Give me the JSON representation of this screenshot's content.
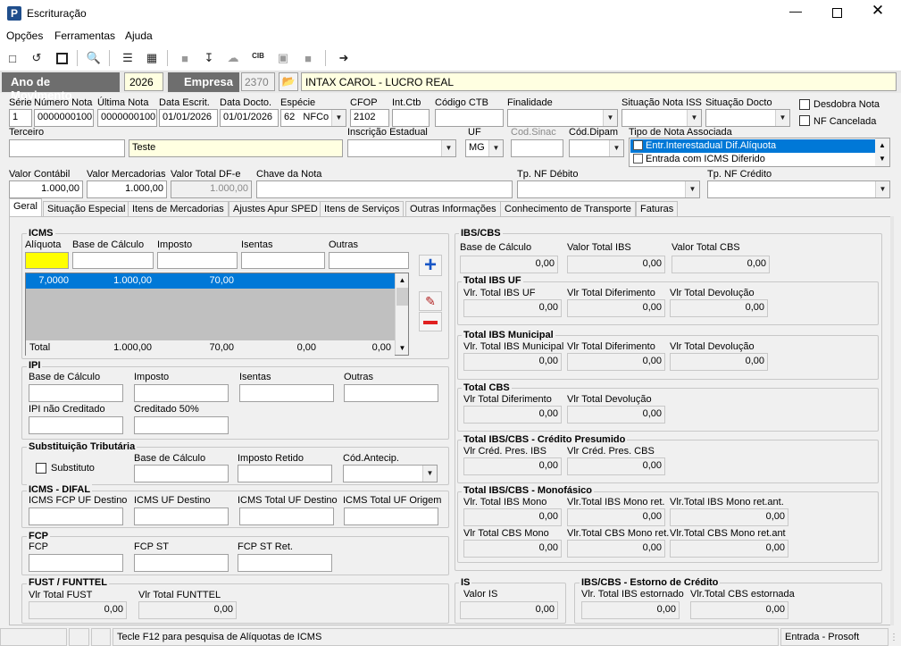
{
  "window": {
    "title": "Escrituração",
    "app_icon": "P"
  },
  "menu": [
    "Opções",
    "Ferramentas",
    "Ajuda"
  ],
  "header": {
    "ano_label": "Ano de Movimento",
    "ano_value": "2026",
    "empresa_label": "Empresa",
    "empresa_code": "2370",
    "empresa_name": "INTAX CAROL - LUCRO REAL"
  },
  "fields": {
    "serie": {
      "label": "Série",
      "value": "1"
    },
    "numero_nota": {
      "label": "Número Nota",
      "value": "0000000100"
    },
    "ultima_nota": {
      "label": "Última Nota",
      "value": "0000000100"
    },
    "data_escrit": {
      "label": "Data Escrit.",
      "value": "01/01/2026"
    },
    "data_docto": {
      "label": "Data Docto.",
      "value": "01/01/2026"
    },
    "especie": {
      "label": "Espécie",
      "code": "62",
      "value": "NFCo"
    },
    "cfop": {
      "label": "CFOP",
      "value": "2102"
    },
    "int_ctb": {
      "label": "Int.Ctb",
      "value": ""
    },
    "codigo_ctb": {
      "label": "Código CTB",
      "value": ""
    },
    "finalidade": {
      "label": "Finalidade",
      "value": ""
    },
    "situacao_nota_iss": {
      "label": "Situação Nota ISS",
      "value": ""
    },
    "situacao_docto": {
      "label": "Situação Docto",
      "value": ""
    },
    "desdobra_nota": "Desdobra Nota",
    "nf_cancelada": "NF Cancelada",
    "terceiro": {
      "label": "Terceiro",
      "code": "",
      "name": "Teste"
    },
    "inscricao_estadual": {
      "label": "Inscrição Estadual",
      "value": ""
    },
    "uf": {
      "label": "UF",
      "value": "MG"
    },
    "cod_sinac": {
      "label": "Cod.Sinac",
      "value": ""
    },
    "cod_dipam": {
      "label": "Cód.Dipam",
      "value": ""
    },
    "tipo_nota_associada": {
      "label": "Tipo de Nota Associada",
      "items": [
        "Entr.Interestadual Dif.Alíquota",
        "Entrada com ICMS Diferido"
      ]
    },
    "valor_contabil": {
      "label": "Valor Contábil",
      "value": "1.000,00"
    },
    "valor_mercadorias": {
      "label": "Valor Mercadorias",
      "value": "1.000,00"
    },
    "valor_total_dfe": {
      "label": "Valor Total DF-e",
      "value": "1.000,00"
    },
    "chave_nota": {
      "label": "Chave da Nota",
      "value": ""
    },
    "tp_nf_debito": {
      "label": "Tp. NF Débito",
      "value": ""
    },
    "tp_nf_credito": {
      "label": "Tp. NF Crédito",
      "value": ""
    }
  },
  "tabs": [
    "Geral",
    "Situação Especial",
    "Itens de Mercadorias",
    "Ajustes Apur SPED",
    "Itens de Serviços",
    "Outras Informações",
    "Conhecimento de Transporte",
    "Faturas"
  ],
  "icms": {
    "title": "ICMS",
    "cols": [
      "Alíquota",
      "Base de Cálculo",
      "Imposto",
      "Isentas",
      "Outras"
    ],
    "row": [
      "7,0000",
      "1.000,00",
      "70,00",
      "",
      ""
    ],
    "total": [
      "Total",
      "1.000,00",
      "70,00",
      "0,00",
      "0,00"
    ]
  },
  "ipi": {
    "title": "IPI",
    "labels": [
      "Base de Cálculo",
      "Imposto",
      "Isentas",
      "Outras",
      "IPI não Creditado",
      "Creditado 50%"
    ]
  },
  "st": {
    "title": "Substituição Tributária",
    "substituto": "Substituto",
    "labels": [
      "Base de Cálculo",
      "Imposto Retido",
      "Cód.Antecip."
    ]
  },
  "difal": {
    "title": "ICMS - DIFAL",
    "labels": [
      "ICMS FCP UF Destino",
      "ICMS UF Destino",
      "ICMS Total UF Destino",
      "ICMS Total UF Origem"
    ]
  },
  "fcp": {
    "title": "FCP",
    "labels": [
      "FCP",
      "FCP ST",
      "FCP ST Ret."
    ]
  },
  "fust": {
    "title": "FUST / FUNTTEL",
    "labels": [
      "Vlr Total FUST",
      "Vlr Total FUNTTEL"
    ],
    "values": [
      "0,00",
      "0,00"
    ]
  },
  "ibscbs": {
    "title": "IBS/CBS",
    "labels": [
      "Base de Cálculo",
      "Valor Total IBS",
      "Valor Total CBS"
    ],
    "values": [
      "0,00",
      "0,00",
      "0,00"
    ],
    "uf": {
      "title": "Total IBS UF",
      "labels": [
        "Vlr. Total IBS UF",
        "Vlr Total Diferimento",
        "Vlr Total Devolução"
      ],
      "values": [
        "0,00",
        "0,00",
        "0,00"
      ]
    },
    "mun": {
      "title": "Total IBS Municipal",
      "labels": [
        "Vlr. Total IBS Municipal",
        "Vlr Total Diferimento",
        "Vlr Total Devolução"
      ],
      "values": [
        "0,00",
        "0,00",
        "0,00"
      ]
    },
    "cbs": {
      "title": "Total CBS",
      "labels": [
        "Vlr Total Diferimento",
        "Vlr Total Devolução"
      ],
      "values": [
        "0,00",
        "0,00"
      ]
    },
    "presumido": {
      "title": "Total IBS/CBS - Crédito Presumido",
      "labels": [
        "Vlr Créd. Pres. IBS",
        "Vlr Créd. Pres. CBS"
      ],
      "values": [
        "0,00",
        "0,00"
      ]
    },
    "mono": {
      "title": "Total IBS/CBS - Monofásico",
      "labels": [
        "Vlr. Total IBS Mono",
        "Vlr.Total IBS Mono ret.",
        "Vlr.Total IBS Mono ret.ant.",
        "Vlr Total CBS Mono",
        "Vlr.Total CBS Mono ret.",
        "Vlr.Total CBS Mono ret.ant"
      ],
      "values": [
        "0,00",
        "0,00",
        "0,00",
        "0,00",
        "0,00",
        "0,00"
      ]
    }
  },
  "is": {
    "title": "IS",
    "label": "Valor IS",
    "value": "0,00"
  },
  "estorno": {
    "title": "IBS/CBS - Estorno de Crédito",
    "labels": [
      "Vlr. Total IBS estornado",
      "Vlr.Total CBS estornada"
    ],
    "values": [
      "0,00",
      "0,00"
    ]
  },
  "status": {
    "hint": "Tecle F12 para pesquisa de Alíquotas de ICMS",
    "mode": "Entrada - Prosoft"
  }
}
